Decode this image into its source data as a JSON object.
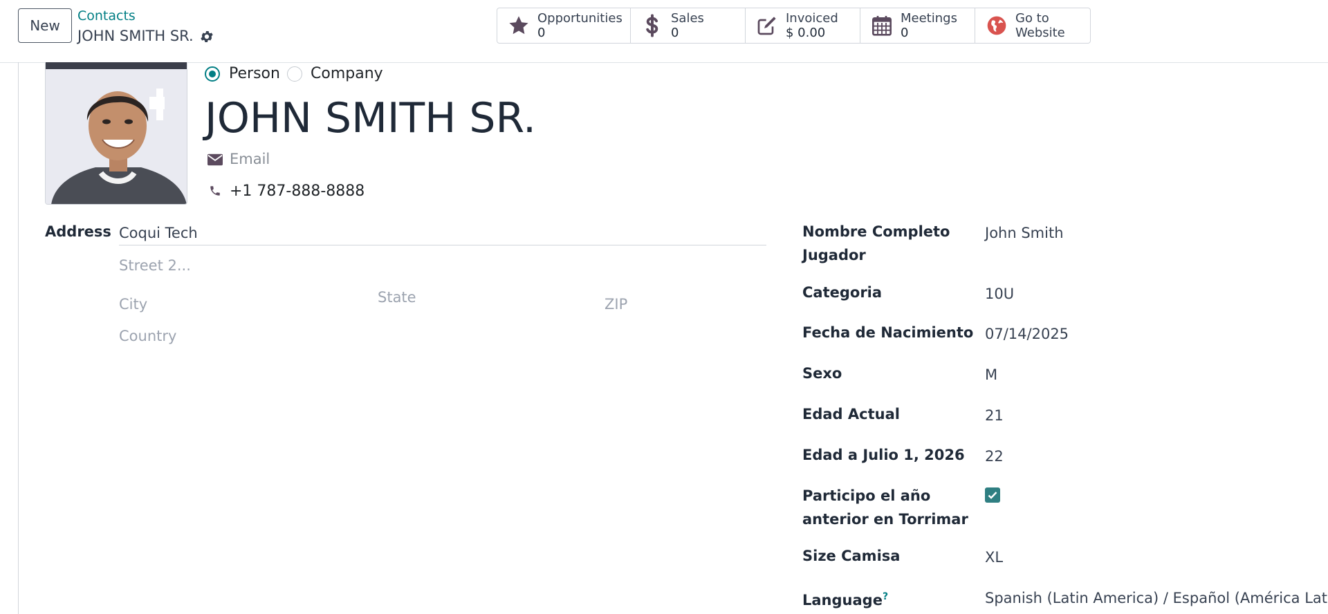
{
  "control_panel": {
    "new_label": "New",
    "breadcrumb_parent": "Contacts",
    "breadcrumb_current": "JOHN SMITH SR."
  },
  "smart_buttons": [
    {
      "label": "Opportunities",
      "value": "0",
      "icon": "star-icon"
    },
    {
      "label": "Sales",
      "value": "0",
      "icon": "dollar-icon"
    },
    {
      "label": "Invoiced",
      "value": "$ 0.00",
      "icon": "pencil-square-icon"
    },
    {
      "label": "Meetings",
      "value": "0",
      "icon": "calendar-icon"
    },
    {
      "label_line1": "Go to",
      "label_line2": "Website",
      "icon": "globe-icon"
    }
  ],
  "form": {
    "type_options": [
      "Person",
      "Company"
    ],
    "type_selected": "Person",
    "name": "JOHN SMITH SR.",
    "email_placeholder": "Email",
    "phone": "+1 787-888-8888",
    "address": {
      "label": "Address",
      "street": "Coqui Tech",
      "street2_placeholder": "Street 2...",
      "city_placeholder": "City",
      "state_placeholder": "State",
      "zip_placeholder": "ZIP",
      "country_placeholder": "Country"
    },
    "fields": {
      "nombre_label_1": "Nombre Completo",
      "nombre_label_2": "Jugador",
      "nombre_value": "John Smith",
      "categoria_label": "Categoria",
      "categoria_value": "10U",
      "fecha_label": "Fecha de Nacimiento",
      "fecha_value": "07/14/2025",
      "sexo_label": "Sexo",
      "sexo_value": "M",
      "edad_label": "Edad Actual",
      "edad_value": "21",
      "edad_julio_label": "Edad a Julio 1, 2026",
      "edad_julio_value": "22",
      "participo_label_1": "Participo el año",
      "participo_label_2": "anterior en Torrimar",
      "participo_checked": true,
      "size_label": "Size Camisa",
      "size_value": "XL",
      "language_label": "Language",
      "language_help": "?",
      "language_value": "Spanish (Latin America) / Español (América Latina)"
    }
  },
  "colors": {
    "accent": "#017e84",
    "checkbox": "#2f7f82",
    "icon": "#5b4a5e",
    "website_icon": "#d9534f"
  }
}
